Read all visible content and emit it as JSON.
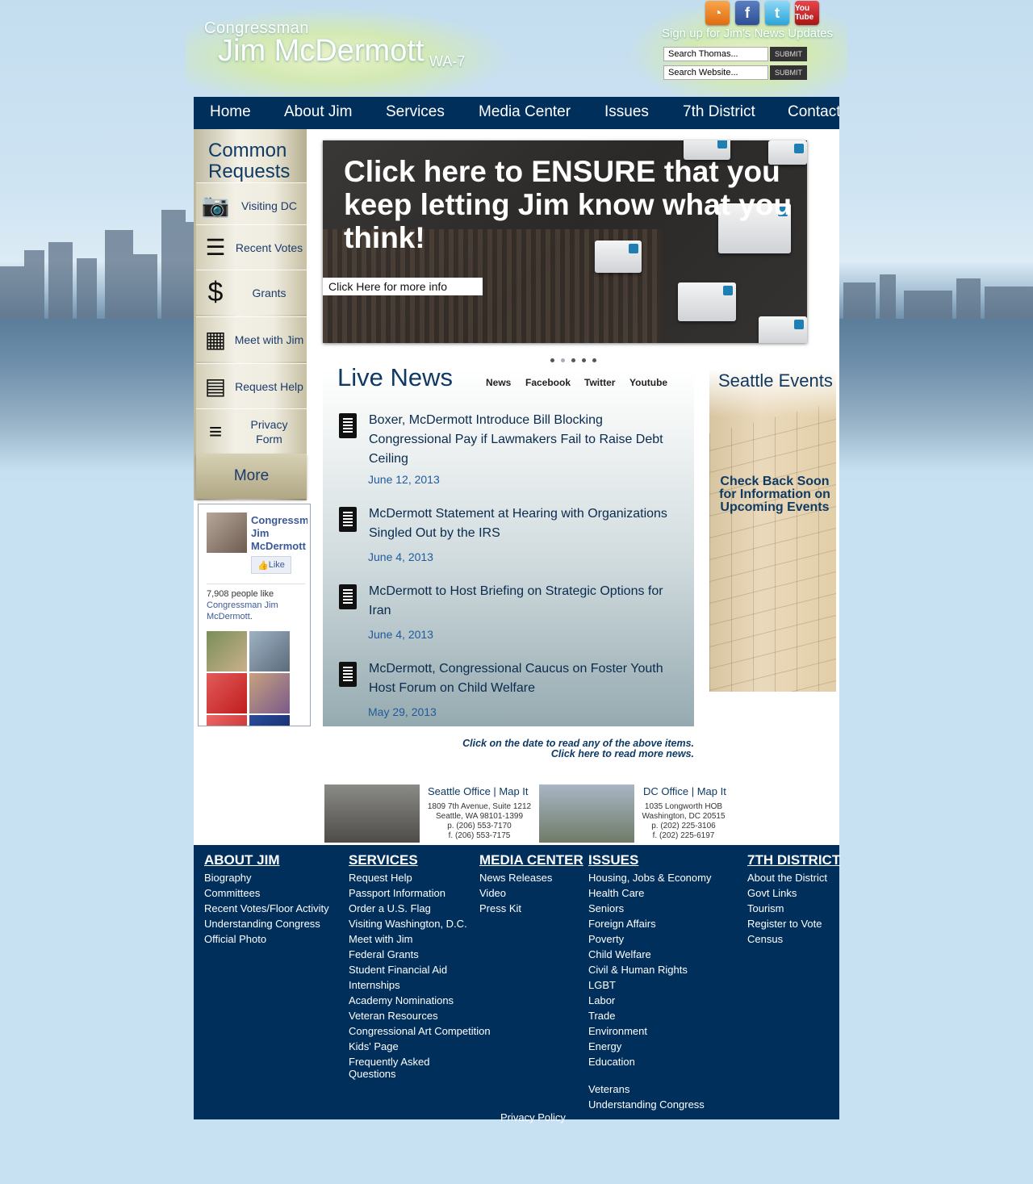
{
  "header": {
    "logo_top": "Congressman",
    "logo_name": "Jim McDermott",
    "logo_district": "WA-7",
    "signup_text": "Sign up for Jim's News Updates",
    "search_thomas_value": "Search Thomas...",
    "search_website_value": "Search Website...",
    "submit_label": "SUBMIT",
    "social": {
      "rss": "RSS",
      "facebook": "f",
      "twitter": "t",
      "youtube": "You Tube"
    }
  },
  "nav": [
    "Home",
    "About Jim",
    "Services",
    "Media Center",
    "Issues",
    "7th District",
    "Contact Jim"
  ],
  "common_requests": {
    "title_line1": "Common",
    "title_line2": "Requests",
    "items": [
      {
        "label": "Visiting DC",
        "icon": "camera-icon"
      },
      {
        "label": "Recent Votes",
        "icon": "list-icon"
      },
      {
        "label": "Grants",
        "icon": "dollar-icon"
      },
      {
        "label": "Meet with Jim",
        "icon": "calendar-icon"
      },
      {
        "label": "Request Help",
        "icon": "id-card-icon"
      },
      {
        "label": "Privacy Form",
        "icon": "document-icon"
      }
    ],
    "more_label": "More"
  },
  "facebook": {
    "page_name": "Congressman Jim McDermott",
    "like_label": "Like",
    "count_text": "7,908 people like",
    "count_link": "Congressman Jim McDermott"
  },
  "banner": {
    "headline": "Click here to ENSURE that you keep letting Jim know what you think!",
    "cta": "Click Here for more info",
    "slide_count": 5,
    "active_slide": 2
  },
  "live_news": {
    "title": "Live News",
    "tabs": [
      "News",
      "Facebook",
      "Twitter",
      "Youtube"
    ],
    "items": [
      {
        "headline": "Boxer, McDermott Introduce Bill Blocking Congressional Pay if Lawmakers Fail to Raise Debt Ceiling",
        "date": "June 12, 2013"
      },
      {
        "headline": "McDermott Statement at Hearing with Organizations Singled Out by the IRS",
        "date": "June 4, 2013"
      },
      {
        "headline": "McDermott to Host Briefing on Strategic Options for Iran",
        "date": "June 4, 2013"
      },
      {
        "headline": "McDermott, Congressional Caucus on Foster Youth Host Forum on Child Welfare",
        "date": "May 29, 2013"
      }
    ],
    "note_line1": "Click on the date to read any of the above items.",
    "note_line2": "Click here to read more news."
  },
  "events": {
    "title": "Seattle Events",
    "message": "Check Back Soon for Information on Upcoming Events"
  },
  "offices": [
    {
      "title": "Seattle Office | Map It",
      "lines": [
        "1809 7th Avenue, Suite 1212",
        "Seattle, WA 98101-1399",
        "p. (206) 553-7170",
        "f. (206) 553-7175"
      ]
    },
    {
      "title": "DC Office | Map It",
      "lines": [
        "1035 Longworth HOB",
        "Washington, DC 20515",
        "p. (202) 225-3106",
        "f. (202) 225-6197"
      ]
    }
  ],
  "footer": {
    "columns": [
      {
        "heading": "ABOUT JIM",
        "links": [
          "Biography",
          "Committees",
          "Recent Votes/Floor Activity",
          "Understanding Congress",
          "Official Photo"
        ]
      },
      {
        "heading": "SERVICES",
        "links": [
          "Request Help",
          "Passport Information",
          "Order a U.S. Flag",
          "Visiting Washington, D.C.",
          "Meet with Jim",
          "Federal Grants",
          "Student Financial Aid",
          "Internships",
          "Academy Nominations",
          "Veteran Resources",
          "Congressional Art Competition",
          "Kids' Page",
          "Frequently Asked Questions"
        ]
      },
      {
        "heading": "MEDIA CENTER",
        "links": [
          "News Releases",
          "Video",
          "Press Kit"
        ]
      },
      {
        "heading": "ISSUES",
        "links": [
          "Housing, Jobs & Economy",
          "Health Care",
          "Seniors",
          "Foreign Affairs",
          "Poverty",
          "Child Welfare",
          "Civil & Human Rights",
          "LGBT",
          "Labor",
          "Trade",
          "Environment",
          "Energy",
          "Education",
          "",
          "Veterans",
          "Understanding Congress"
        ]
      },
      {
        "heading": "7TH DISTRICT",
        "links": [
          "About the District",
          "Govt Links",
          "Tourism",
          "Register to Vote",
          "Census"
        ]
      }
    ],
    "privacy": "Privacy Policy"
  }
}
